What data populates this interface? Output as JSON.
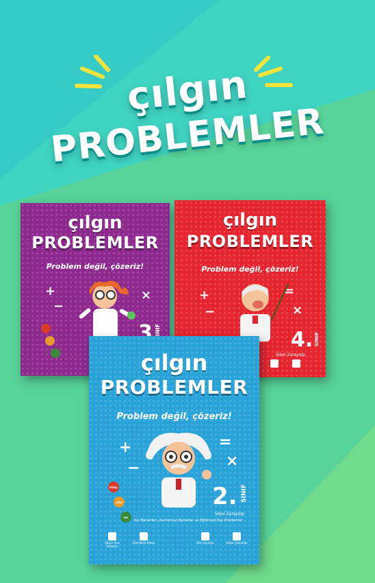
{
  "colors": {
    "background_teal": "#3fd3c2",
    "background_green": "#5fd48b",
    "headline_ray": "#f5e33b",
    "book_grade3": "#8e2a8e",
    "book_grade4": "#e52630",
    "book_grade2": "#2aa3d8"
  },
  "headline": {
    "line1": "çılgın",
    "line2": "PROBLEMLER"
  },
  "books": [
    {
      "id": "grade3",
      "title_line1": "çılgın",
      "title_line2": "PROBLEMLER",
      "slogan": "Problem değil, çözeriz!",
      "grade": "3",
      "grade_suffix": "SINIF",
      "icons": [
        "scientist-illustration",
        "traffic-light-chips"
      ]
    },
    {
      "id": "grade4",
      "title_line1": "çılgın",
      "title_line2": "PROBLEMLER",
      "slogan": "Problem değil, çözeriz!",
      "grade": "4.",
      "grade_suffix": "SINIF",
      "author": "Sibel Zereyalp",
      "icons": [
        "teacher-illustration"
      ]
    },
    {
      "id": "grade2",
      "title_line1": "çılgın",
      "title_line2": "PROBLEMLER",
      "slogan": "Problem değil, çözeriz!",
      "grade": "2.",
      "grade_suffix": "SINIF",
      "author": "Sibel Zereyalp",
      "subtitle": "Kur Becerileri, Kavramsal Beceriler ve Eğitimsel Dışı Problemler",
      "chips": [
        "kolay",
        "orta",
        "zor"
      ],
      "footer_items": [
        "Sözün Sesi Videoları",
        "Etkinlikler Kitabı",
        "Mini Oyunlar",
        "Video Çözümler"
      ]
    }
  ]
}
